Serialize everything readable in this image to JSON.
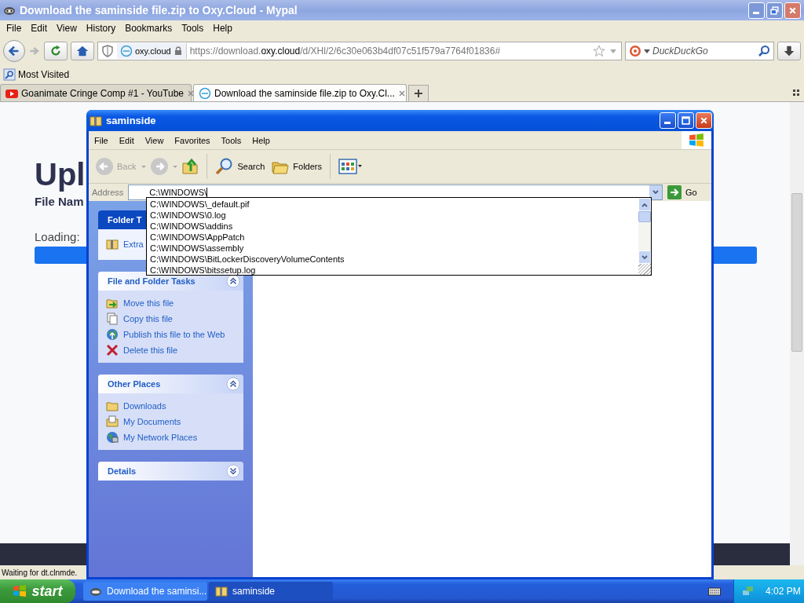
{
  "browser": {
    "title": "Download the saminside file.zip to Oxy.Cloud - Mypal",
    "menu": [
      "File",
      "Edit",
      "View",
      "History",
      "Bookmarks",
      "Tools",
      "Help"
    ],
    "site_identity": "oxy.cloud",
    "url": {
      "prefix": "https://download.",
      "domain": "oxy.cloud",
      "path": "/d/XHl/2/6c30e063b4df07c51f579a7764f01836#"
    },
    "search_placeholder": "DuckDuckGo",
    "bookmarks": [
      "Most Visited"
    ],
    "tabs": [
      {
        "label": "Goanimate Cringe Comp #1 - YouTube",
        "selected": false
      },
      {
        "label": "Download the saminside file.zip to Oxy.Cl...",
        "selected": true
      }
    ],
    "status": "Waiting for dt.clnmde."
  },
  "page": {
    "heading": "Upl",
    "file_name_label": "File Nam",
    "loading_label": "Loading:",
    "progress": {
      "level": 1
    }
  },
  "explorer": {
    "title": "saminside",
    "menu": [
      "File",
      "Edit",
      "View",
      "Favorites",
      "Tools",
      "Help"
    ],
    "back": {
      "label": "Back",
      "disabled": true
    },
    "search_label": "Search",
    "folders_label": "Folders",
    "address_label": "Address",
    "address": "C:\\WINDOWS\\",
    "go_label": "Go",
    "suggestions": [
      "C:\\WINDOWS\\_default.pif",
      "C:\\WINDOWS\\0.log",
      "C:\\WINDOWS\\addins",
      "C:\\WINDOWS\\AppPatch",
      "C:\\WINDOWS\\assembly",
      "C:\\WINDOWS\\BitLockerDiscoveryVolumeContents",
      "C:\\WINDOWS\\bitssetup.log"
    ],
    "panels": [
      {
        "kind": "special",
        "title": "Folder T",
        "items": [
          "Extra"
        ]
      },
      {
        "kind": "normal",
        "title": "File and Folder Tasks",
        "expanded": true,
        "items": [
          "Move this file",
          "Copy this file",
          "Publish this file to the Web",
          "Delete this file"
        ]
      },
      {
        "kind": "normal",
        "title": "Other Places",
        "expanded": true,
        "items": [
          "Downloads",
          "My Documents",
          "My Network Places"
        ]
      },
      {
        "kind": "normal",
        "title": "Details",
        "expanded": false
      }
    ]
  },
  "taskbar": {
    "start": "start",
    "tasks": [
      {
        "label": "Download the saminsi...",
        "selected": false
      },
      {
        "label": "saminside",
        "selected": true
      }
    ],
    "clock": "4:02 PM"
  }
}
